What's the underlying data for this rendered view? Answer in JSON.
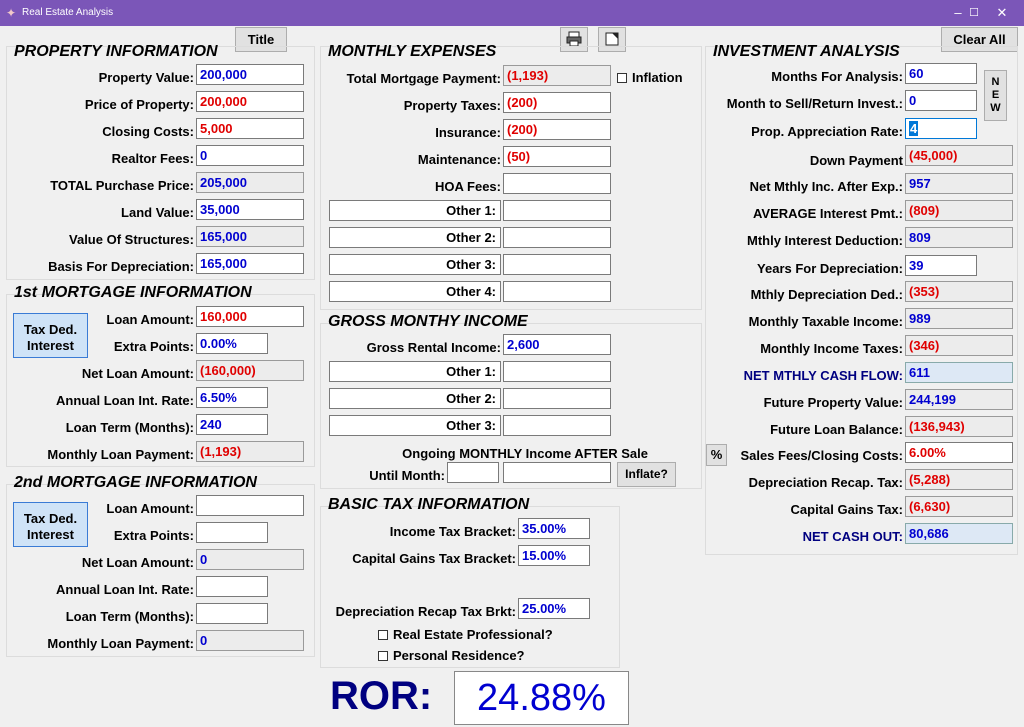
{
  "window": {
    "title": "Real Estate Analysis",
    "minimize": "–",
    "maximize": "☐",
    "close": "✕"
  },
  "buttons": {
    "title": "Title",
    "clear_all": "Clear All",
    "tax_ded": "Tax Ded. Interest",
    "new": "N E W",
    "percent": "%",
    "inflate": "Inflate?"
  },
  "property": {
    "heading": "PROPERTY INFORMATION",
    "rows": [
      {
        "label": "Property Value:",
        "value": "200,000"
      },
      {
        "label": "Price of Property:",
        "value": "200,000"
      },
      {
        "label": "Closing Costs:",
        "value": "5,000"
      },
      {
        "label": "Realtor Fees:",
        "value": "0"
      },
      {
        "label": "TOTAL Purchase Price:",
        "value": "205,000"
      },
      {
        "label": "Land Value:",
        "value": "35,000"
      },
      {
        "label": "Value Of Structures:",
        "value": "165,000"
      },
      {
        "label": "Basis For Depreciation:",
        "value": "165,000"
      }
    ]
  },
  "mortgage1": {
    "heading": "1st MORTGAGE INFORMATION",
    "rows": [
      {
        "label": "Loan Amount:",
        "value": "160,000"
      },
      {
        "label": "Extra Points:",
        "value": "0.00%"
      },
      {
        "label": "Net Loan Amount:",
        "value": "(160,000)"
      },
      {
        "label": "Annual Loan Int. Rate:",
        "value": "6.50%"
      },
      {
        "label": "Loan Term (Months):",
        "value": "240"
      },
      {
        "label": "Monthly Loan Payment:",
        "value": "(1,193)"
      }
    ]
  },
  "mortgage2": {
    "heading": "2nd MORTGAGE INFORMATION",
    "rows": [
      {
        "label": "Loan Amount:",
        "value": ""
      },
      {
        "label": "Extra Points:",
        "value": ""
      },
      {
        "label": "Net Loan Amount:",
        "value": "0"
      },
      {
        "label": "Annual Loan Int. Rate:",
        "value": ""
      },
      {
        "label": "Loan Term (Months):",
        "value": ""
      },
      {
        "label": "Monthly Loan Payment:",
        "value": "0"
      }
    ]
  },
  "expenses": {
    "heading": "MONTHLY EXPENSES",
    "inflation_label": "Inflation",
    "rows": [
      {
        "label": "Total Mortgage Payment:",
        "value": "(1,193)"
      },
      {
        "label": "Property Taxes:",
        "value": "(200)"
      },
      {
        "label": "Insurance:",
        "value": "(200)"
      },
      {
        "label": "Maintenance:",
        "value": "(50)"
      },
      {
        "label": "HOA Fees:",
        "value": ""
      }
    ],
    "others": [
      "Other 1:",
      "Other 2:",
      "Other 3:",
      "Other 4:"
    ]
  },
  "income": {
    "heading": "GROSS MONTHY INCOME",
    "gross_label": "Gross Rental Income:",
    "gross_value": "2,600",
    "others": [
      "Other 1:",
      "Other 2:",
      "Other 3:"
    ],
    "after_sale": "Ongoing MONTHLY Income AFTER Sale",
    "until_month": "Until Month:"
  },
  "tax": {
    "heading": "BASIC TAX INFORMATION",
    "rows": [
      {
        "label": "Income Tax Bracket:",
        "value": "35.00%"
      },
      {
        "label": "Capital Gains Tax Bracket:",
        "value": "15.00%"
      },
      {
        "label": "Depreciation Recap Tax Brkt:",
        "value": "25.00%"
      }
    ],
    "real_estate_pro": "Real Estate Professional?",
    "personal_residence": "Personal Residence?"
  },
  "investment": {
    "heading": "INVESTMENT ANALYSIS",
    "rows": [
      {
        "label": "Months For Analysis:",
        "value": "60"
      },
      {
        "label": "Month to Sell/Return Invest.:",
        "value": "0"
      },
      {
        "label": "Prop. Appreciation Rate:",
        "value": "4"
      },
      {
        "label": "Down Payment",
        "value": "(45,000)"
      },
      {
        "label": "Net Mthly Inc. After Exp.:",
        "value": "957"
      },
      {
        "label": "AVERAGE Interest Pmt.:",
        "value": "(809)"
      },
      {
        "label": "Mthly Interest Deduction:",
        "value": "809"
      },
      {
        "label": "Years For Depreciation:",
        "value": "39"
      },
      {
        "label": "Mthly Depreciation Ded.:",
        "value": "(353)"
      },
      {
        "label": "Monthly Taxable Income:",
        "value": "989"
      },
      {
        "label": "Monthly Income Taxes:",
        "value": "(346)"
      },
      {
        "label": "NET MTHLY CASH FLOW:",
        "value": "611"
      },
      {
        "label": "Future Property Value:",
        "value": "244,199"
      },
      {
        "label": "Future Loan Balance:",
        "value": "(136,943)"
      },
      {
        "label": "Sales Fees/Closing Costs:",
        "value": "6.00%"
      },
      {
        "label": "Depreciation Recap. Tax:",
        "value": "(5,288)"
      },
      {
        "label": "Capital Gains Tax:",
        "value": "(6,630)"
      },
      {
        "label": "NET CASH OUT:",
        "value": "80,686"
      }
    ]
  },
  "ror": {
    "label": "ROR:",
    "value": "24.88%"
  },
  "icons": {
    "print": "printer-icon",
    "window": "restore-icon"
  }
}
